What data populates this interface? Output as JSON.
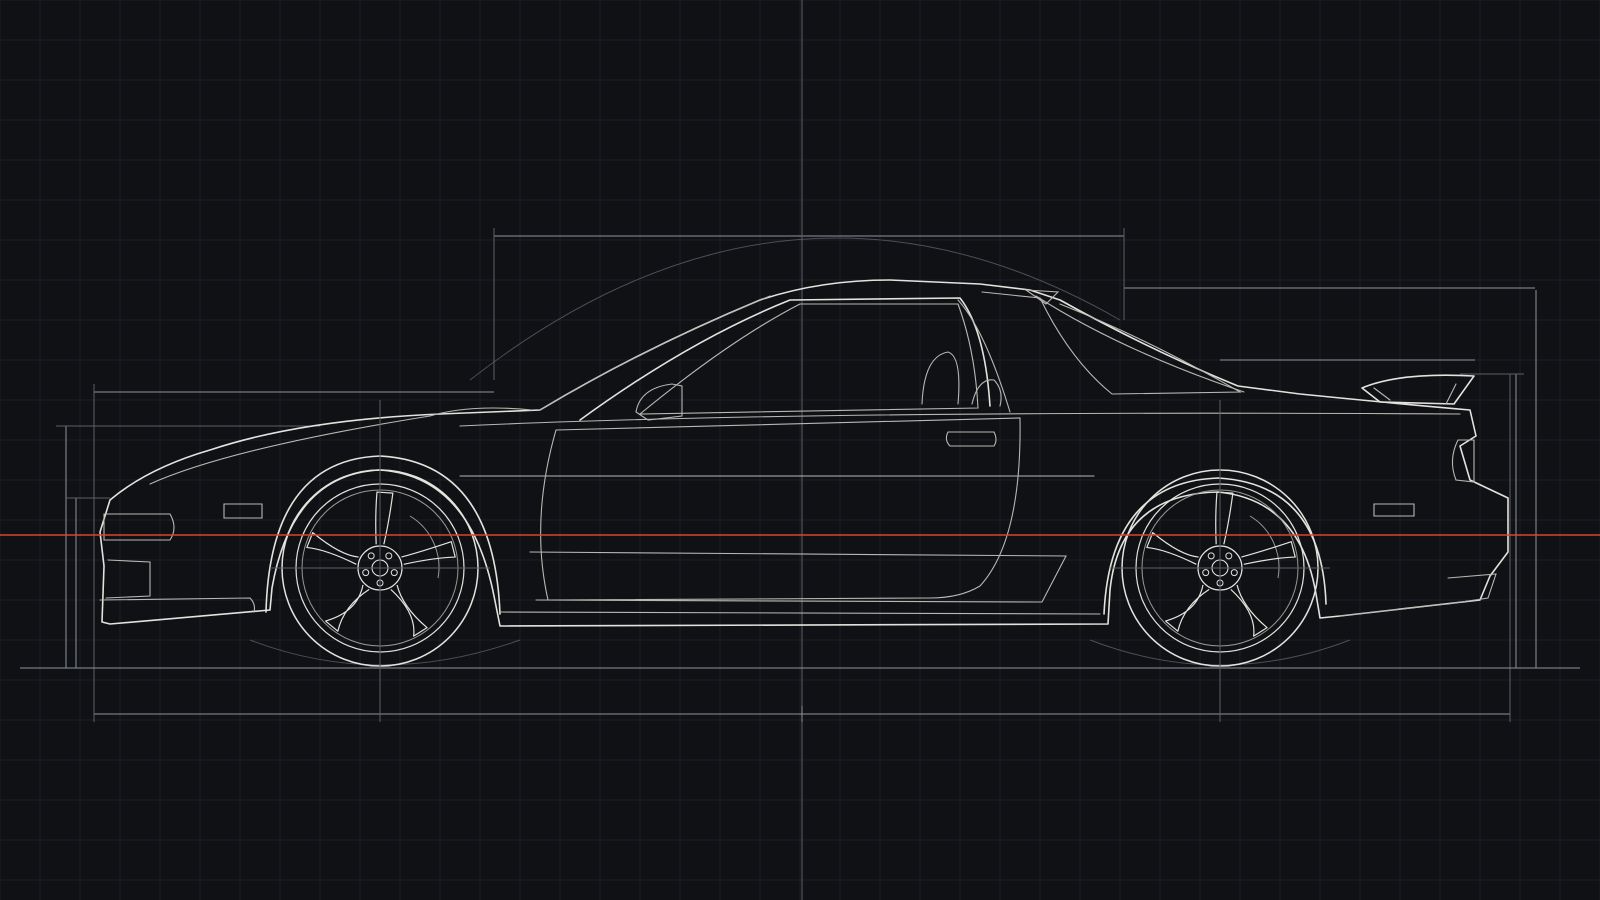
{
  "colors": {
    "background": "#0f1115",
    "grid": "#1c2027",
    "line": "#e4e2dc",
    "dimension": "#8f929a",
    "centerline": "#d9462a"
  },
  "drawing": {
    "subject": "sports-coupe-side-elevation",
    "view": "side",
    "grid": true,
    "wheels": 2,
    "wheel_spokes": 5,
    "wheel_lugs": 5
  }
}
